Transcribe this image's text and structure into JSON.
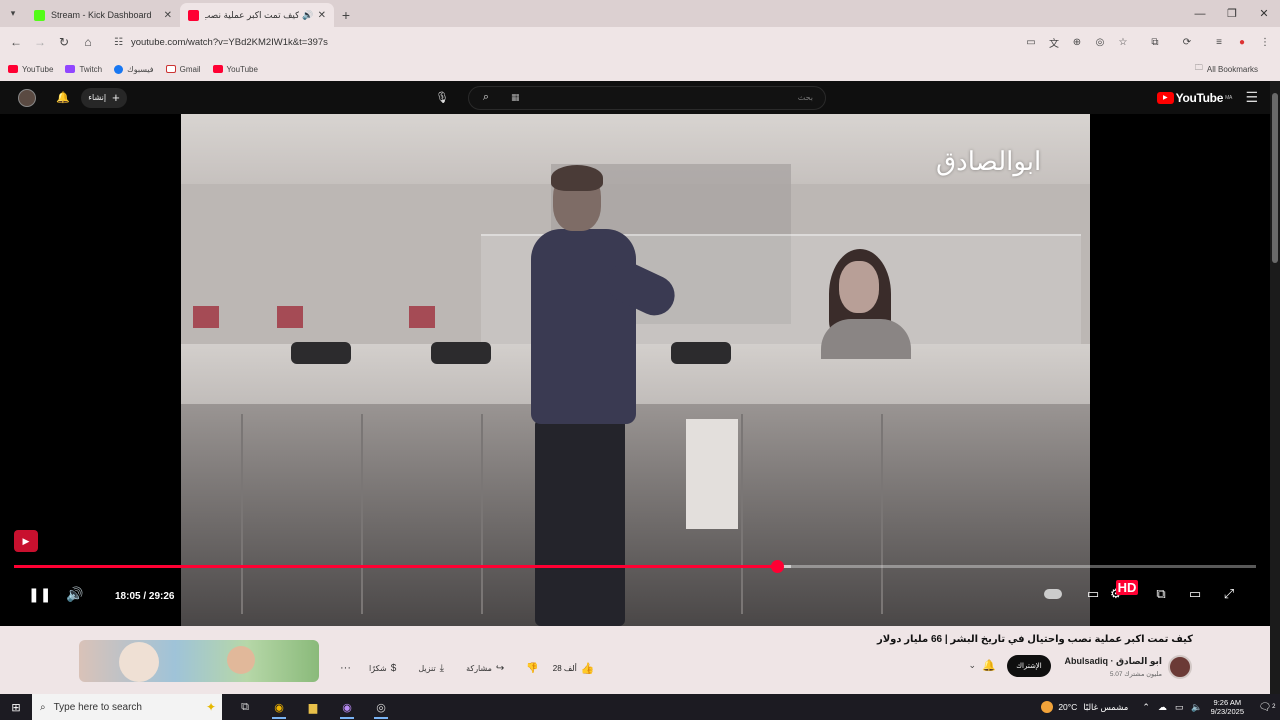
{
  "browser": {
    "tabs": [
      {
        "title": "Stream - Kick Dashboard",
        "favicon_color": "#53fc18",
        "active": false
      },
      {
        "title": "كيف تمت اكبر عملية نصب و",
        "favicon_color": "#ff0033",
        "active": true
      }
    ],
    "url": "youtube.com/watch?v=YBd2KM2IW1k&t=397s",
    "bookmarks": [
      {
        "label": "YouTube",
        "color": "#ff0033"
      },
      {
        "label": "Twitch",
        "color": "#9146ff"
      },
      {
        "label": "فيسبوك",
        "color": "#1877f2"
      },
      {
        "label": "Gmail",
        "color": "#ffffff"
      },
      {
        "label": "YouTube",
        "color": "#ff0033"
      }
    ],
    "all_bookmarks": "All Bookmarks"
  },
  "youtube": {
    "logo_text": "YouTube",
    "logo_region": "MA",
    "search_placeholder": "بحث",
    "create_label": "إنشاء",
    "player": {
      "watermark": "ابوالصادق",
      "time_current": "18:05",
      "time_total": "29:26",
      "time_display": "18:05 / 29:26",
      "progress": 0.614,
      "buffered": 0.626,
      "hd_badge": "HD"
    },
    "video": {
      "title": "كيف تمت اكبر عملية نصب واحتيال في تاريخ البشر | 66 مليار دولار",
      "channel_name": "Abulsadiq · ابو الصادق",
      "subscribers": "5.07 مليون مشترك",
      "subscribe_label": "الإشتراك",
      "likes": "28 ألف",
      "share_label": "مشاركة",
      "download_label": "تنزيل",
      "thanks_label": "شكرًا"
    }
  },
  "taskbar": {
    "search_placeholder": "Type here to search",
    "weather_temp": "20°C",
    "weather_text": "مشمس غالبًا",
    "time": "9:26 AM",
    "date": "9/23/2025",
    "notification_count": "2"
  },
  "colors": {
    "accent": "#ff0033",
    "chrome_bg": "#efe5e6",
    "youtube_dark": "#0f0f0f"
  }
}
